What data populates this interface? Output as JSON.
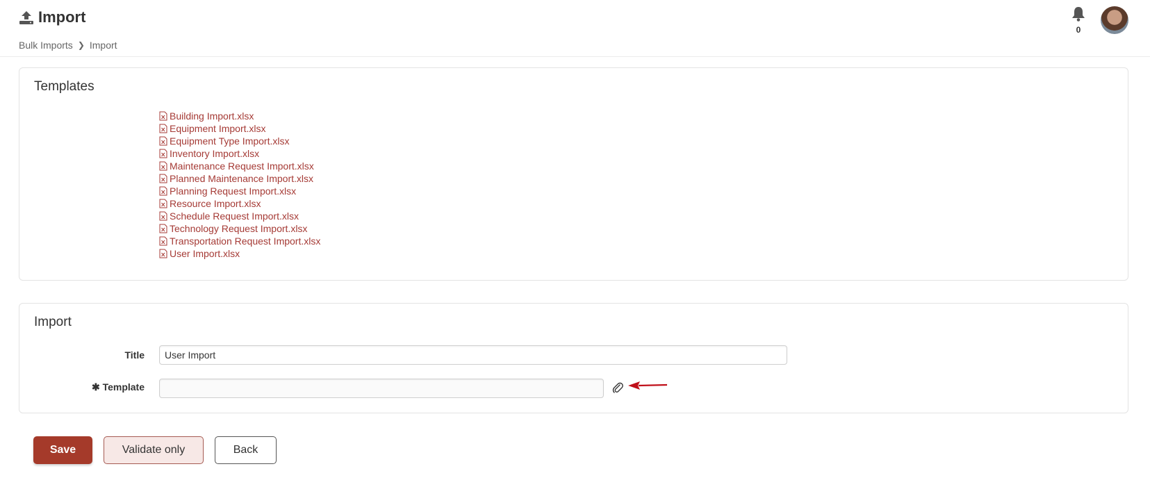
{
  "header": {
    "title": "Import",
    "breadcrumb": [
      "Bulk Imports",
      "Import"
    ],
    "notification_count": "0",
    "icons": {
      "title": "upload-icon",
      "bell": "bell-icon",
      "avatar": "user-avatar"
    }
  },
  "templates": {
    "heading": "Templates",
    "files": [
      "Building Import.xlsx",
      "Equipment Import.xlsx",
      "Equipment Type Import.xlsx",
      "Inventory Import.xlsx",
      "Maintenance Request Import.xlsx",
      "Planned Maintenance Import.xlsx",
      "Planning Request Import.xlsx",
      "Resource Import.xlsx",
      "Schedule Request Import.xlsx",
      "Technology Request Import.xlsx",
      "Transportation Request Import.xlsx",
      "User Import.xlsx"
    ]
  },
  "import": {
    "heading": "Import",
    "title_label": "Title",
    "title_value": "User Import",
    "template_label": "✱ Template",
    "template_value": ""
  },
  "buttons": {
    "save": "Save",
    "validate": "Validate only",
    "back": "Back"
  },
  "colors": {
    "accent": "#a53a2a",
    "link": "#a53a35",
    "arrow": "#c0101a"
  }
}
